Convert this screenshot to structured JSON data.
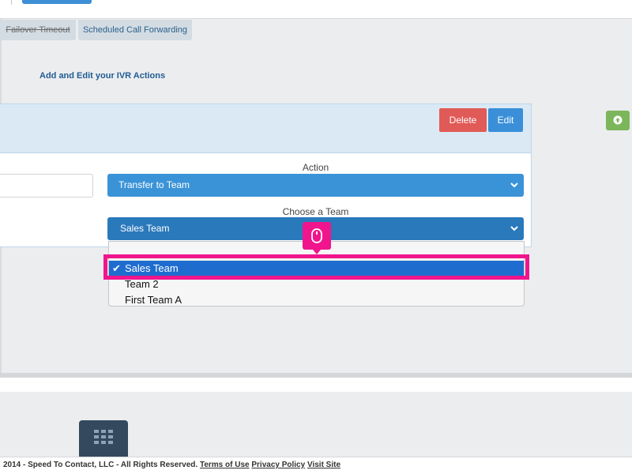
{
  "tabs": {
    "failover": "Failover Timeout",
    "forwarding": "Scheduled Call Forwarding"
  },
  "section": {
    "title": "Add and Edit your IVR Actions"
  },
  "panel": {
    "delete_label": "Delete",
    "edit_label": "Edit",
    "action_label": "Action",
    "action_value": "Transfer to Team",
    "team_label": "Choose a Team",
    "team_value": "Sales Team"
  },
  "dropdown": {
    "options": [
      "Sales Team",
      "Team 2",
      "First Team A"
    ],
    "selected_index": 0,
    "check_glyph": "✔"
  },
  "footer": {
    "copyright": "2014 - Speed To Contact, LLC - All Rights Reserved.",
    "terms": "Terms of Use",
    "privacy": "Privacy Policy",
    "visit": "Visit Site"
  },
  "colors": {
    "accent": "#3a93d7",
    "delete": "#e05a57",
    "highlight": "#f0158d",
    "success": "#7cb65a",
    "selected_option": "#1f6ccf"
  },
  "icons": {
    "chevron": "chevron-down-icon",
    "arrow": "arrow-up-circle-icon",
    "mouse": "mouse-icon",
    "grid": "keypad-grid-icon"
  }
}
